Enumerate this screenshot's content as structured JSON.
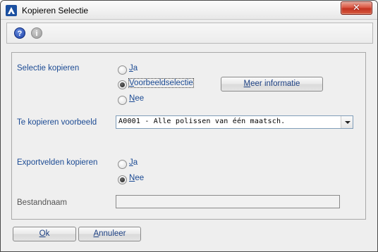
{
  "window": {
    "title": "Kopieren Selectie",
    "close_glyph": "✕"
  },
  "toolbar": {
    "help_icon": "?",
    "info_icon": "i"
  },
  "form": {
    "selectie_kopieren": {
      "label": "Selectie kopieren",
      "options": [
        {
          "accel": "J",
          "rest": "a",
          "selected": false
        },
        {
          "accel": "V",
          "rest": "oorbeeldselectie",
          "selected": true
        },
        {
          "accel": "N",
          "rest": "ee",
          "selected": false
        }
      ]
    },
    "meer_informatie": {
      "accel": "M",
      "rest": "eer informatie"
    },
    "te_kopieren_voorbeeld": {
      "label": "Te kopieren voorbeeld",
      "value": "A0001 - Alle polissen van één maatsch."
    },
    "exportvelden_kopieren": {
      "label": "Exportvelden kopieren",
      "options": [
        {
          "accel": "J",
          "rest": "a",
          "selected": false
        },
        {
          "accel": "N",
          "rest": "ee",
          "selected": true
        }
      ]
    },
    "bestandnaam": {
      "label": "Bestandnaam",
      "value": ""
    }
  },
  "buttons": {
    "ok": {
      "accel": "O",
      "rest": "k"
    },
    "annuleer": {
      "accel": "A",
      "rest": "nnuleer"
    }
  },
  "colors": {
    "label_blue": "#1b4a93",
    "close_red": "#c23220",
    "accent_blue": "#1a4fa0"
  }
}
